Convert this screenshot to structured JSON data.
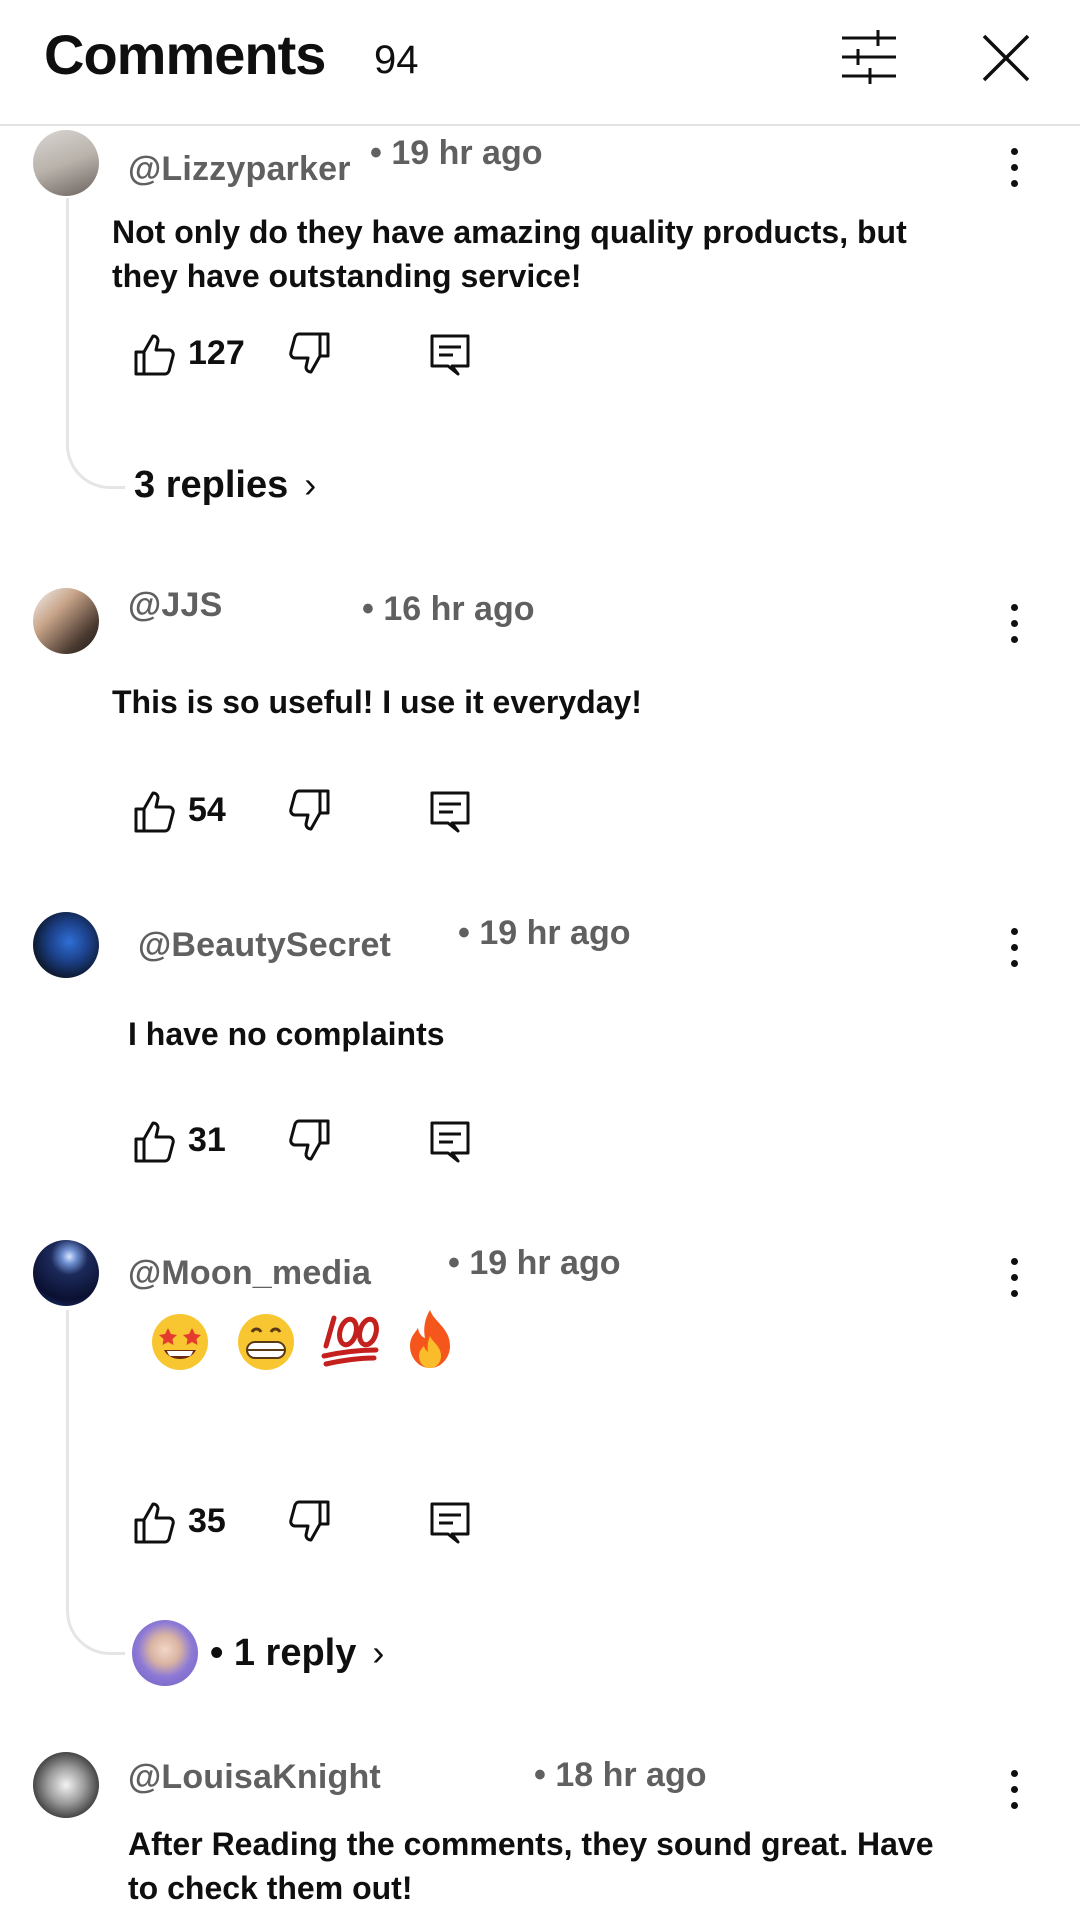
{
  "header": {
    "title": "Comments",
    "count": "94",
    "icons": [
      "filter-sliders-icon",
      "close-icon"
    ]
  },
  "comments": [
    {
      "handle": "@Lizzyparker",
      "time": "• 19 hr ago",
      "text_lines": [
        "Not only do they have amazing quality products, but",
        "they have outstanding service!"
      ],
      "likes": "127",
      "replies_label": "3 replies"
    },
    {
      "handle": "@JJS",
      "time": "• 16 hr ago",
      "text_lines": [
        "This is so useful! I use it everyday!"
      ],
      "likes": "54"
    },
    {
      "handle": "@BeautySecret",
      "time": "• 19 hr ago",
      "text_lines": [
        "I have no complaints"
      ],
      "likes": "31"
    },
    {
      "handle": "@Moon_media",
      "time": "• 19 hr ago",
      "emojis": [
        "star-struck-emoji",
        "grinning-emoji",
        "hundred-points-emoji",
        "fire-emoji"
      ],
      "likes": "35",
      "replies_label": "• 1 reply"
    },
    {
      "handle": "@LouisaKnight",
      "time": "• 18 hr ago",
      "text_lines": [
        "After Reading the comments, they sound great. Have",
        "to check them out!"
      ]
    }
  ],
  "colors": {
    "background": "#ffffff",
    "primary_text": "#0f0f0f",
    "secondary_text": "#606060",
    "divider": "#e3e3e3"
  }
}
